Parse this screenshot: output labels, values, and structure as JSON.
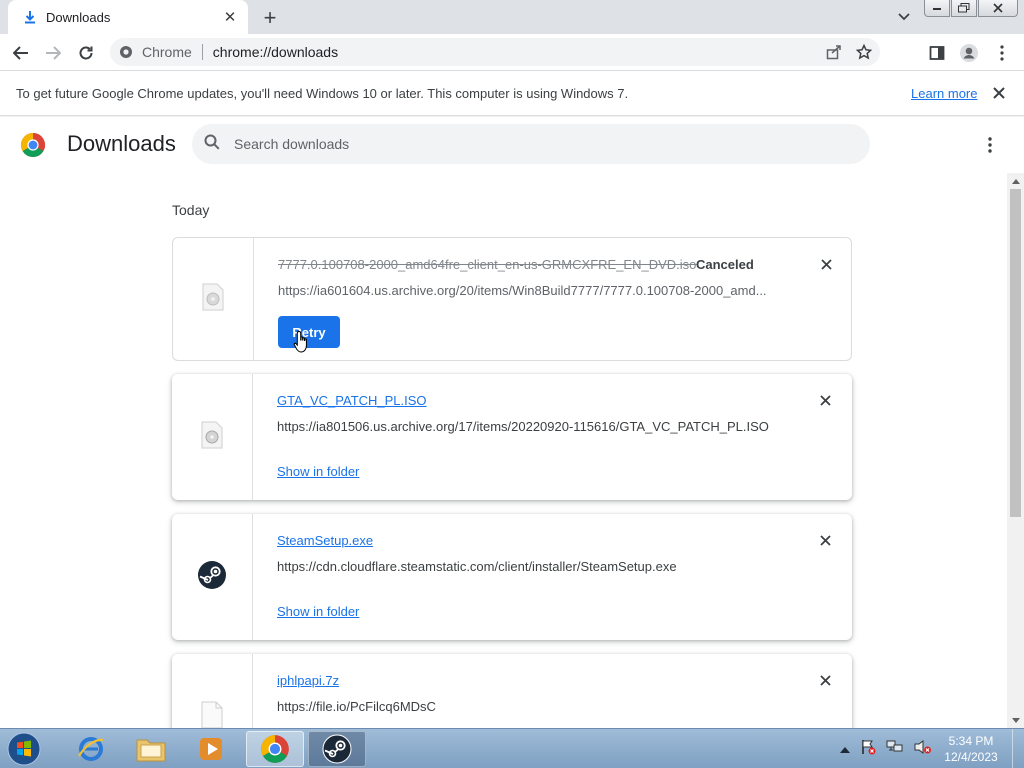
{
  "tab": {
    "title": "Downloads"
  },
  "toolbar": {
    "site_name": "Chrome",
    "url": "chrome://downloads"
  },
  "infobar": {
    "message": "To get future Google Chrome updates, you'll need Windows 10 or later. This computer is using Windows 7.",
    "learn_more": "Learn more"
  },
  "header": {
    "title": "Downloads",
    "search_placeholder": "Search downloads"
  },
  "section": {
    "label": "Today"
  },
  "downloads": [
    {
      "filename": "7777.0.100708-2000_amd64fre_client_en-us-GRMCXFRE_EN_DVD.iso",
      "status": "Canceled",
      "url": "https://ia601604.us.archive.org/20/items/Win8Build7777/7777.0.100708-2000_amd...",
      "action": "Retry",
      "icon": "disc-file-icon"
    },
    {
      "filename": "GTA_VC_PATCH_PL.ISO",
      "url": "https://ia801506.us.archive.org/17/items/20220920-115616/GTA_VC_PATCH_PL.ISO",
      "action": "Show in folder",
      "icon": "disc-file-icon"
    },
    {
      "filename": "SteamSetup.exe",
      "url": "https://cdn.cloudflare.steamstatic.com/client/installer/SteamSetup.exe",
      "action": "Show in folder",
      "icon": "steam-icon"
    },
    {
      "filename": "iphlpapi.7z",
      "url": "https://file.io/PcFilcq6MDsC",
      "icon": "blank-file-icon"
    }
  ],
  "taskbar": {
    "time": "5:34 PM",
    "date": "12/4/2023"
  },
  "colors": {
    "accent": "#1a73e8",
    "taskbar": "#8fb0d0"
  }
}
